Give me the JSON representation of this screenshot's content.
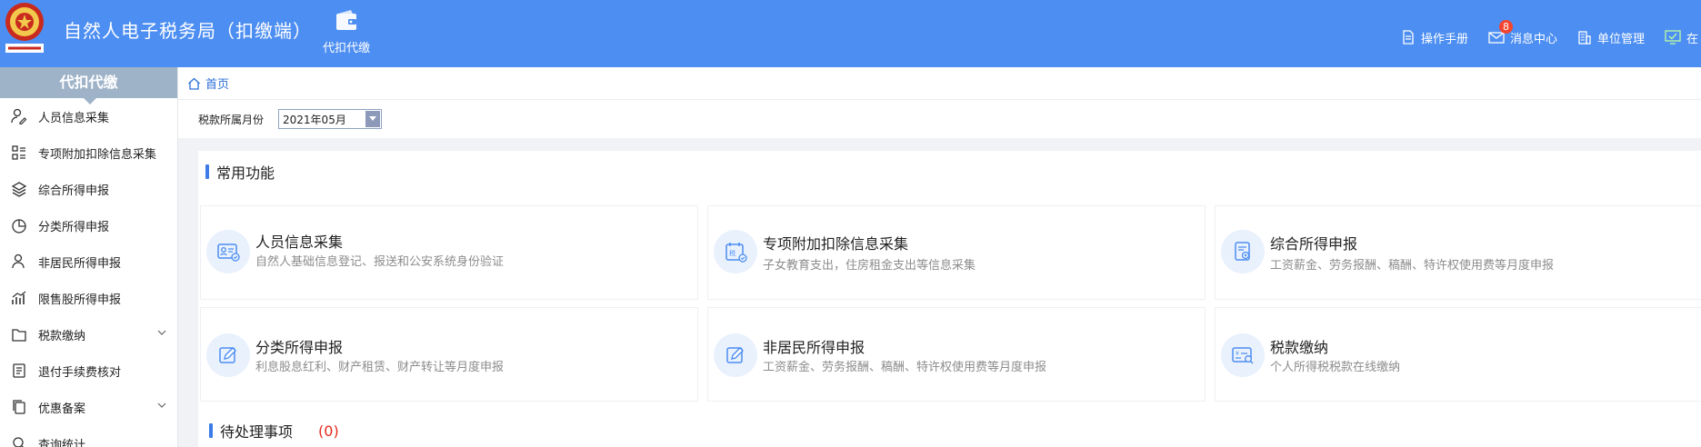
{
  "header": {
    "title": "自然人电子税务局（扣缴端）",
    "logo_icon": "tax-bureau-emblem-icon",
    "nav": {
      "label": "代扣代缴",
      "icon": "wallet-icon"
    },
    "actions": [
      {
        "label": "操作手册",
        "icon": "document-icon"
      },
      {
        "label": "消息中心",
        "icon": "mail-icon",
        "badge": "8"
      },
      {
        "label": "单位管理",
        "icon": "building-icon"
      },
      {
        "label": "在",
        "icon": "monitor-check-icon"
      }
    ]
  },
  "sidebar": {
    "title": "代扣代缴",
    "items": [
      {
        "label": "人员信息采集",
        "icon": "user-edit-icon"
      },
      {
        "label": "专项附加扣除信息采集",
        "icon": "list-icon"
      },
      {
        "label": "综合所得申报",
        "icon": "layers-icon"
      },
      {
        "label": "分类所得申报",
        "icon": "pie-icon"
      },
      {
        "label": "非居民所得申报",
        "icon": "user-icon"
      },
      {
        "label": "限售股所得申报",
        "icon": "bar-chart-icon"
      },
      {
        "label": "税款缴纳",
        "icon": "folder-icon",
        "expandable": true
      },
      {
        "label": "退付手续费核对",
        "icon": "receipt-icon"
      },
      {
        "label": "优惠备案",
        "icon": "copy-icon",
        "expandable": true
      },
      {
        "label": "查询统计",
        "icon": "search-icon"
      }
    ]
  },
  "breadcrumb": {
    "home": "首页",
    "icon": "home-icon"
  },
  "filter": {
    "label": "税款所属月份",
    "value": "2021年05月"
  },
  "common": {
    "title": "常用功能",
    "cards": [
      {
        "title": "人员信息采集",
        "desc": "自然人基础信息登记、报送和公安系统身份验证",
        "icon": "id-card-icon"
      },
      {
        "title": "专项附加扣除信息采集",
        "desc": "子女教育支出，住房租金支出等信息采集",
        "icon": "tax-calendar-icon"
      },
      {
        "title": "综合所得申报",
        "desc": "工资薪金、劳务报酬、稿酬、特许权使用费等月度申报",
        "icon": "report-icon"
      },
      {
        "title": "分类所得申报",
        "desc": "利息股息红利、财产租赁、财产转让等月度申报",
        "icon": "edit-icon"
      },
      {
        "title": "非居民所得申报",
        "desc": "工资薪金、劳务报酬、稿酬、特许权使用费等月度申报",
        "icon": "edit-icon"
      },
      {
        "title": "税款缴纳",
        "desc": "个人所得税税款在线缴纳",
        "icon": "payment-search-icon"
      }
    ]
  },
  "pending": {
    "title": "待处理事项",
    "count": "(0)"
  },
  "colors": {
    "header": "#4d8ef2",
    "accent": "#3d7ce8",
    "danger": "#e8281c",
    "sidebar_head": "#9fb3c8"
  }
}
